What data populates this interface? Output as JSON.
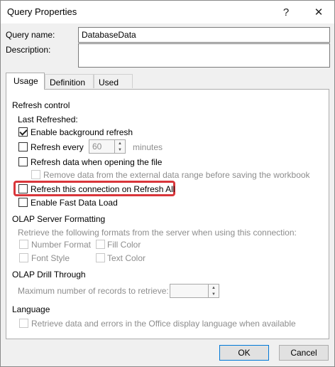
{
  "window": {
    "title": "Query Properties",
    "help_label": "?",
    "close_label": "✕"
  },
  "query": {
    "name_label": "Query name:",
    "name_value": "DatabaseData",
    "description_label": "Description:",
    "description_value": ""
  },
  "tabs": [
    {
      "label": "Usage",
      "active": true
    },
    {
      "label": "Definition",
      "active": false
    },
    {
      "label": "Used In",
      "active": false
    }
  ],
  "refresh_control": {
    "heading": "Refresh control",
    "last_refreshed": "Last Refreshed:",
    "background_refresh": {
      "label": "Enable background refresh",
      "checked": true
    },
    "refresh_every": {
      "label": "Refresh every",
      "checked": false,
      "value": "60",
      "unit": "minutes"
    },
    "refresh_on_open": {
      "label": "Refresh data when opening the file",
      "checked": false
    },
    "remove_data": {
      "label": "Remove data from the external data range before saving the workbook",
      "checked": false,
      "enabled": false
    },
    "refresh_all": {
      "label": "Refresh this connection on Refresh All",
      "checked": false,
      "highlighted": true
    },
    "fast_load": {
      "label": "Enable Fast Data Load",
      "checked": false
    }
  },
  "olap_formatting": {
    "heading": "OLAP Server Formatting",
    "description": "Retrieve the following formats from the server when using this connection:",
    "number_format": "Number Format",
    "fill_color": "Fill Color",
    "font_style": "Font Style",
    "text_color": "Text Color"
  },
  "olap_drill": {
    "heading": "OLAP Drill Through",
    "max_records_label": "Maximum number of records to retrieve:",
    "max_records_value": ""
  },
  "language": {
    "heading": "Language",
    "retrieve_label": "Retrieve data and errors in the Office display language when available"
  },
  "buttons": {
    "ok": "OK",
    "cancel": "Cancel"
  },
  "colors": {
    "highlight": "#d9363b",
    "accent": "#0078d7"
  }
}
